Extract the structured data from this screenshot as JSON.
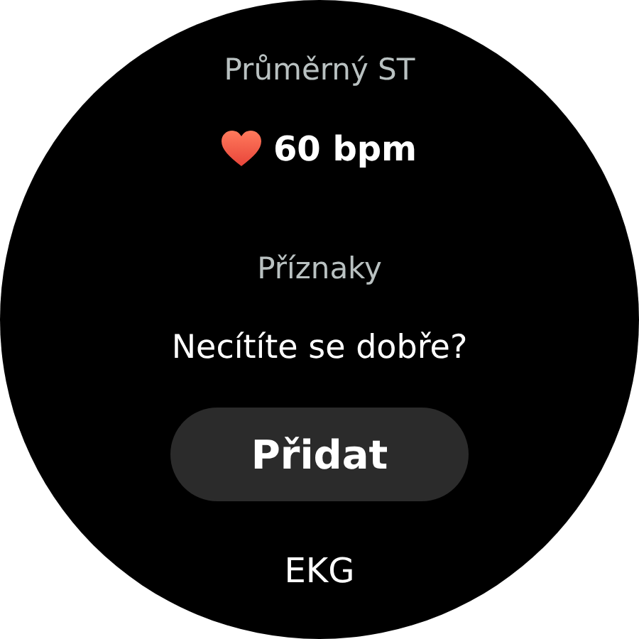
{
  "average_hr": {
    "label": "Průměrný ST",
    "value": "60 bpm"
  },
  "symptoms": {
    "label": "Příznaky",
    "prompt": "Necítíte se dobře?",
    "button": "Přidat"
  },
  "next_section": {
    "label": "EKG"
  }
}
